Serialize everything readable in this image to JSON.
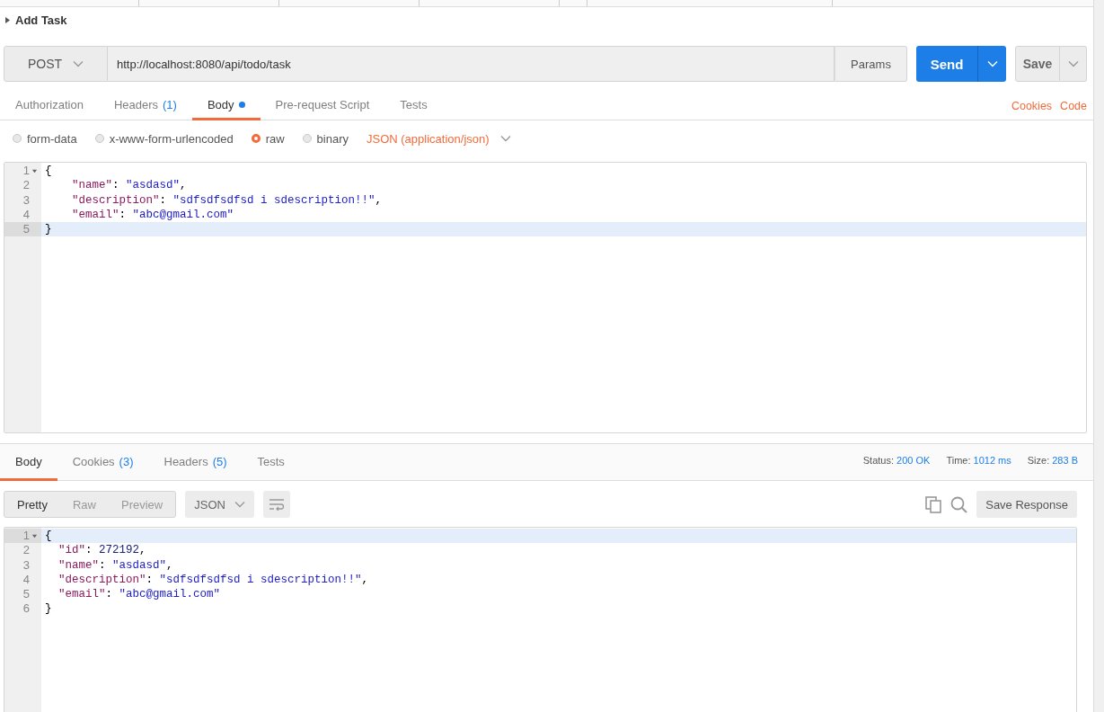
{
  "request_name": "Add Task",
  "request": {
    "method": "POST",
    "url": "http://localhost:8080/api/todo/task",
    "params_button": "Params",
    "send_button": "Send",
    "save_button": "Save"
  },
  "request_tabs": [
    {
      "label": "Authorization",
      "selected": false
    },
    {
      "label": "Headers",
      "count": "(1)",
      "selected": false
    },
    {
      "label": "Body",
      "selected": true,
      "modified": true
    },
    {
      "label": "Pre-request Script",
      "selected": false
    },
    {
      "label": "Tests",
      "selected": false
    }
  ],
  "request_links": [
    "Cookies",
    "Code"
  ],
  "body_modes": [
    {
      "label": "form-data",
      "selected": false
    },
    {
      "label": "x-www-form-urlencoded",
      "selected": false
    },
    {
      "label": "raw",
      "selected": true
    },
    {
      "label": "binary",
      "selected": false
    }
  ],
  "content_type": "JSON (application/json)",
  "request_body": {
    "lines": [
      {
        "number": "1",
        "fold": true,
        "current": false,
        "tokens": [
          {
            "kind": "punct",
            "text": "{"
          }
        ]
      },
      {
        "number": "2",
        "fold": false,
        "current": false,
        "tokens": [
          {
            "kind": "key",
            "text": "    \"name\""
          },
          {
            "kind": "punct",
            "text": ": "
          },
          {
            "kind": "string",
            "text": "\"asdasd\""
          },
          {
            "kind": "punct",
            "text": ","
          }
        ]
      },
      {
        "number": "3",
        "fold": false,
        "current": false,
        "tokens": [
          {
            "kind": "key",
            "text": "    \"description\""
          },
          {
            "kind": "punct",
            "text": ": "
          },
          {
            "kind": "string",
            "text": "\"sdfsdfsdfsd i sdescription!!\""
          },
          {
            "kind": "punct",
            "text": ","
          }
        ]
      },
      {
        "number": "4",
        "fold": false,
        "current": false,
        "tokens": [
          {
            "kind": "key",
            "text": "    \"email\""
          },
          {
            "kind": "punct",
            "text": ": "
          },
          {
            "kind": "string",
            "text": "\"abc@gmail.com\""
          }
        ]
      },
      {
        "number": "5",
        "fold": false,
        "current": true,
        "tokens": [
          {
            "kind": "punct",
            "text": "}"
          }
        ]
      }
    ]
  },
  "response_tabs": [
    {
      "label": "Body",
      "selected": true
    },
    {
      "label": "Cookies",
      "count": "(3)",
      "selected": false
    },
    {
      "label": "Headers",
      "count": "(5)",
      "selected": false
    },
    {
      "label": "Tests",
      "selected": false
    }
  ],
  "response_stats": [
    {
      "label": "Status:",
      "value": "200 OK"
    },
    {
      "label": "Time:",
      "value": "1012 ms"
    },
    {
      "label": "Size:",
      "value": "283 B"
    }
  ],
  "view_modes": [
    {
      "label": "Pretty",
      "selected": true
    },
    {
      "label": "Raw",
      "selected": false
    },
    {
      "label": "Preview",
      "selected": false
    }
  ],
  "format": "JSON",
  "save_response_button": "Save Response",
  "response_body": {
    "lines": [
      {
        "number": "1",
        "fold": true,
        "current": true,
        "tokens": [
          {
            "kind": "punct",
            "text": "{"
          }
        ]
      },
      {
        "number": "2",
        "fold": false,
        "current": false,
        "tokens": [
          {
            "kind": "key",
            "text": "  \"id\""
          },
          {
            "kind": "punct",
            "text": ": "
          },
          {
            "kind": "number",
            "text": "272192"
          },
          {
            "kind": "punct",
            "text": ","
          }
        ]
      },
      {
        "number": "3",
        "fold": false,
        "current": false,
        "tokens": [
          {
            "kind": "key",
            "text": "  \"name\""
          },
          {
            "kind": "punct",
            "text": ": "
          },
          {
            "kind": "string",
            "text": "\"asdasd\""
          },
          {
            "kind": "punct",
            "text": ","
          }
        ]
      },
      {
        "number": "4",
        "fold": false,
        "current": false,
        "tokens": [
          {
            "kind": "key",
            "text": "  \"description\""
          },
          {
            "kind": "punct",
            "text": ": "
          },
          {
            "kind": "string",
            "text": "\"sdfsdfsdfsd i sdescription!!\""
          },
          {
            "kind": "punct",
            "text": ","
          }
        ]
      },
      {
        "number": "5",
        "fold": false,
        "current": false,
        "tokens": [
          {
            "kind": "key",
            "text": "  \"email\""
          },
          {
            "kind": "punct",
            "text": ": "
          },
          {
            "kind": "string",
            "text": "\"abc@gmail.com\""
          }
        ]
      },
      {
        "number": "6",
        "fold": false,
        "current": false,
        "tokens": [
          {
            "kind": "punct",
            "text": "}"
          }
        ]
      }
    ]
  }
}
